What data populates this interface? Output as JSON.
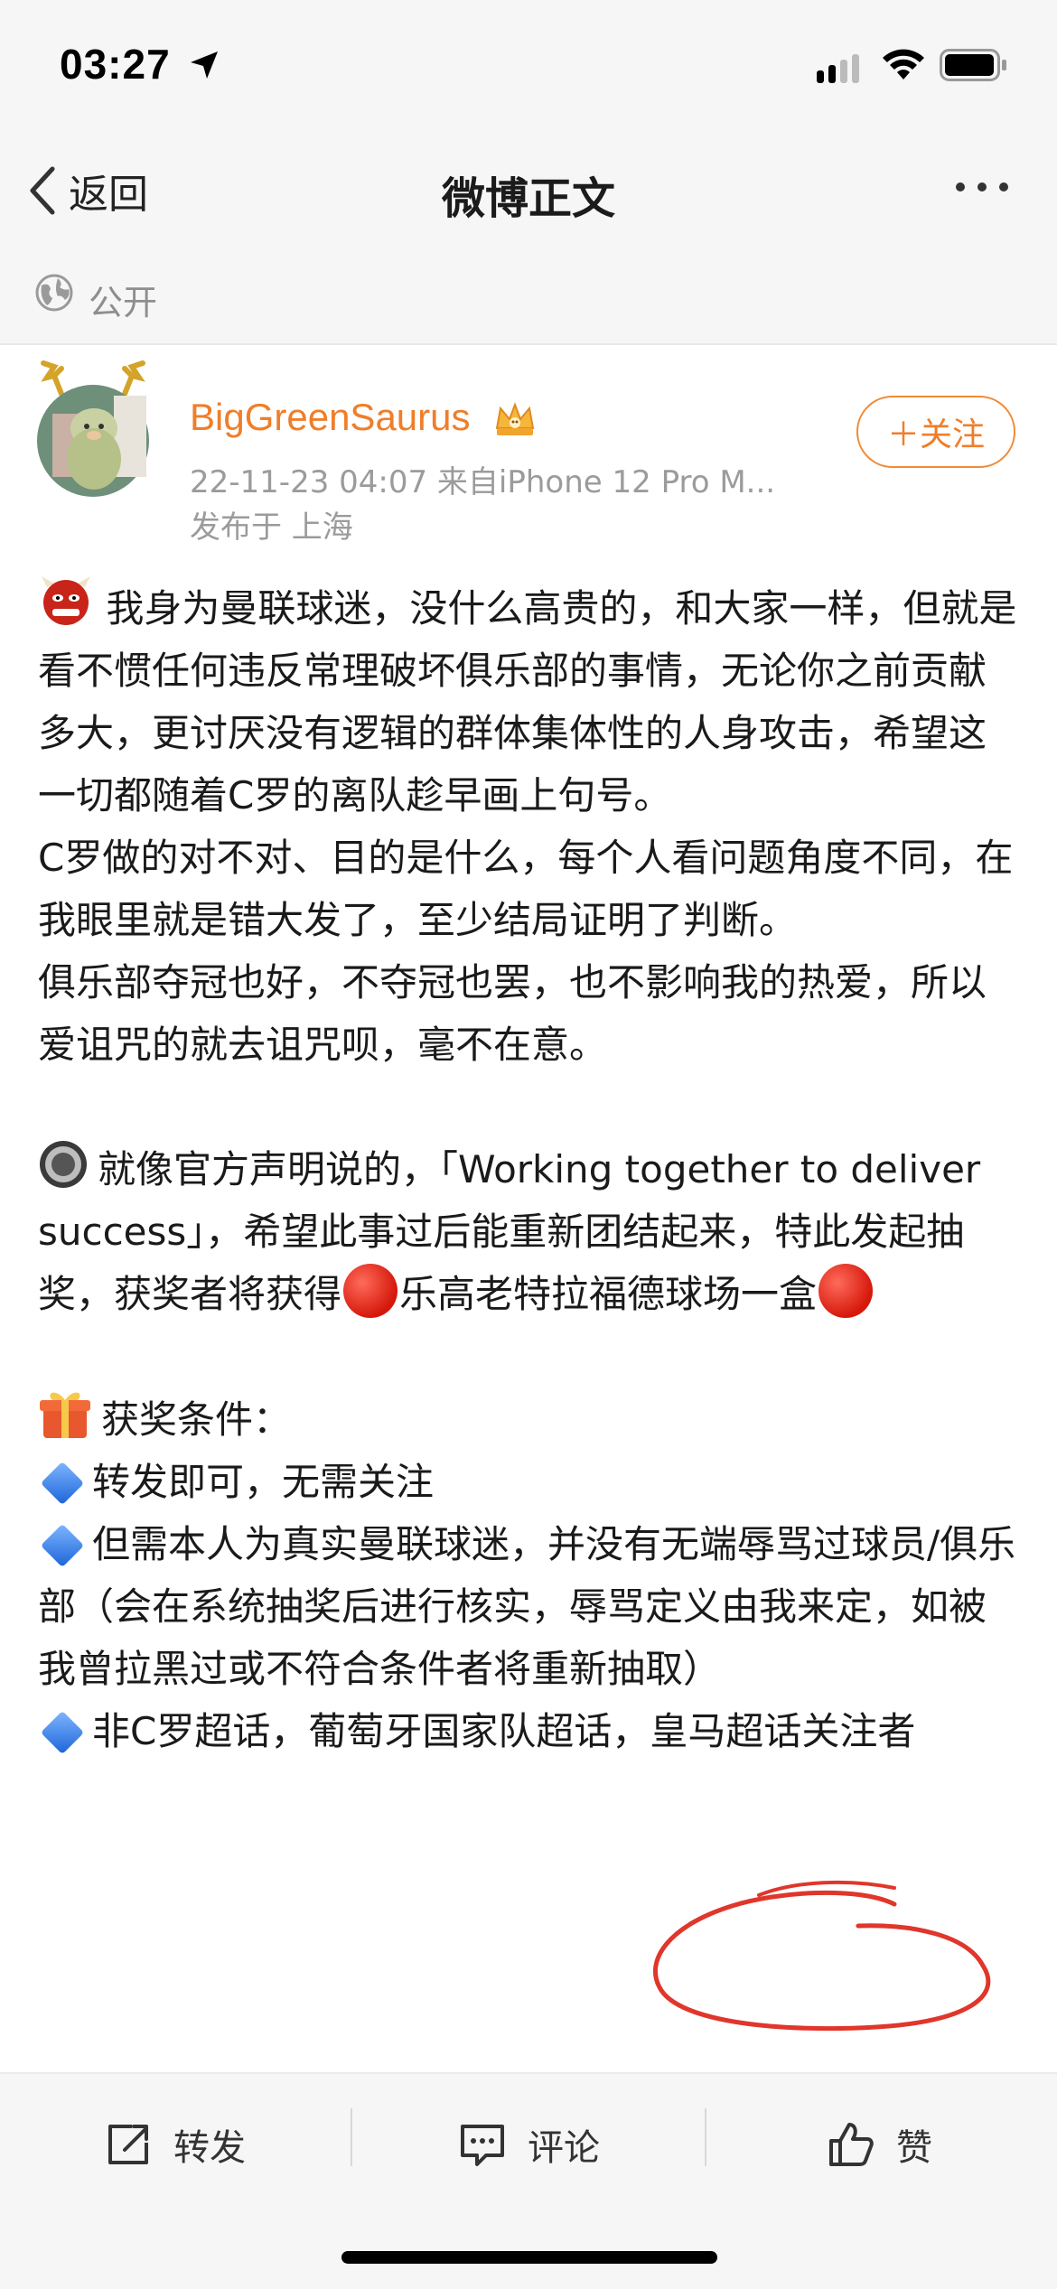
{
  "status_bar": {
    "time": "03:27"
  },
  "nav": {
    "back_label": "返回",
    "title": "微博正文"
  },
  "visibility": {
    "label": "公开"
  },
  "author": {
    "name": "BigGreenSaurus",
    "meta": "22-11-23 04:07  来自iPhone 12 Pro M...",
    "location": "发布于 上海",
    "follow_label": "＋关注"
  },
  "post": {
    "p1": "我身为曼联球迷，没什么高贵的，和大家一样，但就是看不惯任何违反常理破坏俱乐部的事情，无论你之前贡献多大，更讨厌没有逻辑的群体集体性的人身攻击，希望这一切都随着C罗的离队趁早画上句号。",
    "p2": "C罗做的对不对、目的是什么，每个人看问题角度不同，在我眼里就是错大发了，至少结局证明了判断。",
    "p3": "俱乐部夺冠也好，不夺冠也罢，也不影响我的热爱，所以爱诅咒的就去诅咒呗，毫不在意。",
    "p4a": "就像官方声明说的，「Working together to deliver success」，希望此事过后能重新团结起来，特此发起抽奖，获奖者将获得",
    "p4b": "乐高老特拉福德球场一盒",
    "p5": "获奖条件：",
    "c1": "转发即可，无需关注",
    "c2": "但需本人为真实曼联球迷，并没有无端辱骂过球员/俱乐部（会在系统抽奖后进行核实，辱骂定义由我来定，如被我曾拉黑过或不符合条件者将重新抽取）",
    "c3": "非C罗超话，葡萄牙国家队超话，皇马超话关注者"
  },
  "actions": {
    "repost": "转发",
    "comment": "评论",
    "like": "赞"
  },
  "colors": {
    "accent": "#ef7e2a",
    "annotation": "#e0362b"
  }
}
